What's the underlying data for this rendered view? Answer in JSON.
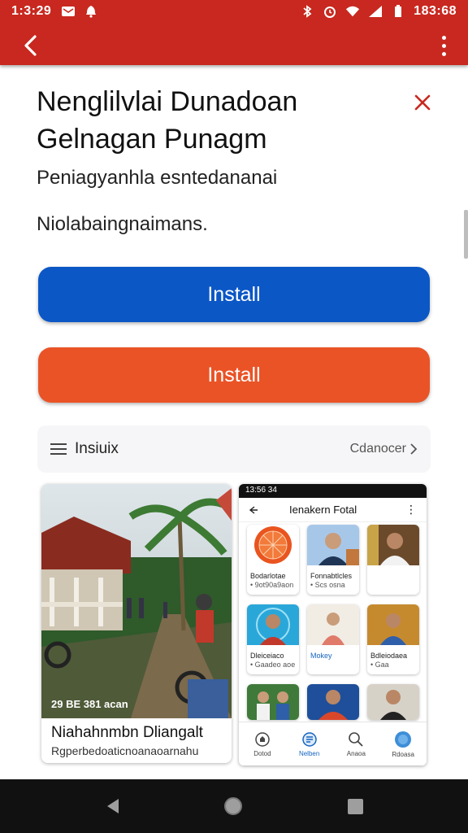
{
  "status_bar": {
    "time": "1:3:29",
    "right_text": "183:68",
    "icons": [
      "message-icon",
      "notification-icon",
      "bluetooth-icon",
      "alarm-icon",
      "wifi-icon",
      "signal-icon",
      "battery-icon"
    ]
  },
  "app_bar": {
    "back_icon": "arrow-back-icon",
    "menu_icon": "more-vert-icon",
    "color": "#c8281f"
  },
  "content": {
    "title_line1": "Nenglilvlai Dunadoan",
    "title_line2": "Gelnagan Punagm",
    "subtitle": "Peniagyanhla esntedananai",
    "description": "Niolabaingnaimans.",
    "close_icon": "close-icon"
  },
  "buttons": {
    "install_primary": {
      "label": "Install",
      "color": "#0b57c6"
    },
    "install_secondary": {
      "label": "Install",
      "color": "#ea5326"
    }
  },
  "section": {
    "label": "Insiuix",
    "more_label": "Cdanocer"
  },
  "gallery": {
    "photo": {
      "caption": "29 BE 381 acan",
      "title": "Niahahnmbn Dliangalt",
      "subtitle": "Rgperbedoaticnoanaoarnahu"
    },
    "screenshot": {
      "status": "13:56 34",
      "title": "Ienakern Fotal",
      "tiles": [
        {
          "line1": "Bodarlotae",
          "line2": "• 9ot90a9aon"
        },
        {
          "line1": "Fonnabtlcles",
          "line2": "• Scs osna"
        },
        {
          "line1": "",
          "line2": ""
        },
        {
          "line1": "Dleiceiaco",
          "line2": "• Gaadeo aoe"
        },
        {
          "line1": "Mokey",
          "line2": ""
        },
        {
          "line1": "Bdleiodaea",
          "line2": "• Gaa"
        }
      ],
      "nav": [
        {
          "label": "Dotod",
          "icon": "home-icon"
        },
        {
          "label": "Nelben",
          "icon": "apps-icon"
        },
        {
          "label": "Anaoa",
          "icon": "search-icon"
        },
        {
          "label": "Rdoasa",
          "icon": "profile-icon"
        }
      ]
    }
  },
  "system_nav": {
    "back": "nav-back-icon",
    "home": "nav-home-icon",
    "recents": "nav-recents-icon"
  }
}
